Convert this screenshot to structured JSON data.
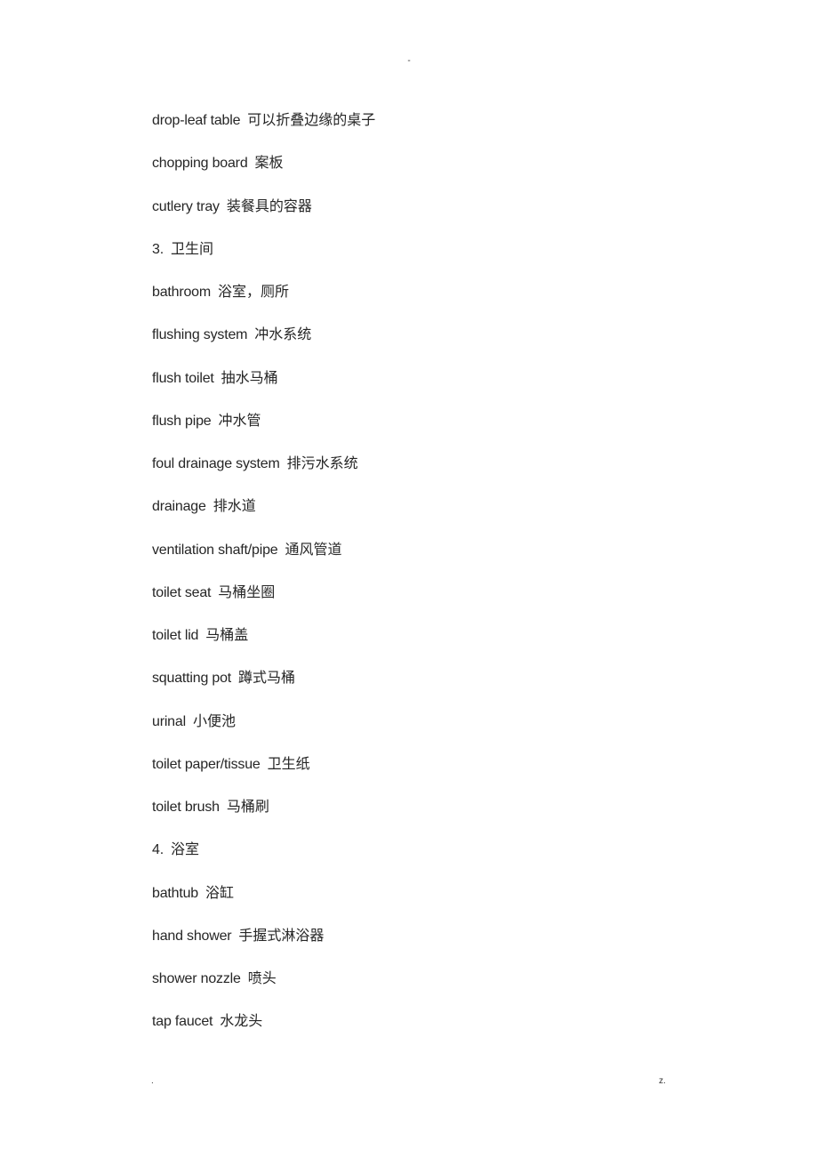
{
  "header": {
    "mark": "-"
  },
  "entries": [
    {
      "en": "drop-leaf table",
      "zh": "可以折叠边缘的桌子"
    },
    {
      "en": "chopping board",
      "zh": "案板"
    },
    {
      "en": "cutlery tray",
      "zh": "装餐具的容器"
    },
    {
      "en": "3.",
      "zh": "卫生间"
    },
    {
      "en": "bathroom",
      "zh": "浴室，厕所"
    },
    {
      "en": "flushing system",
      "zh": "冲水系统"
    },
    {
      "en": "flush toilet",
      "zh": "抽水马桶"
    },
    {
      "en": "flush pipe",
      "zh": "冲水管"
    },
    {
      "en": "foul drainage system",
      "zh": "排污水系统"
    },
    {
      "en": "drainage",
      "zh": "排水道"
    },
    {
      "en": "ventilation shaft/pipe",
      "zh": "通风管道"
    },
    {
      "en": "toilet seat",
      "zh": "马桶坐圈"
    },
    {
      "en": "toilet lid",
      "zh": "马桶盖"
    },
    {
      "en": "squatting pot",
      "zh": "蹲式马桶"
    },
    {
      "en": "urinal",
      "zh": "小便池"
    },
    {
      "en": "toilet paper/tissue",
      "zh": "卫生纸"
    },
    {
      "en": "toilet brush",
      "zh": "马桶刷"
    },
    {
      "en": "4.",
      "zh": "浴室"
    },
    {
      "en": "bathtub",
      "zh": "浴缸"
    },
    {
      "en": "hand shower",
      "zh": "手握式淋浴器"
    },
    {
      "en": "shower nozzle",
      "zh": "喷头"
    },
    {
      "en": "tap faucet",
      "zh": "水龙头"
    }
  ],
  "footer": {
    "left": ".",
    "right": "z."
  }
}
